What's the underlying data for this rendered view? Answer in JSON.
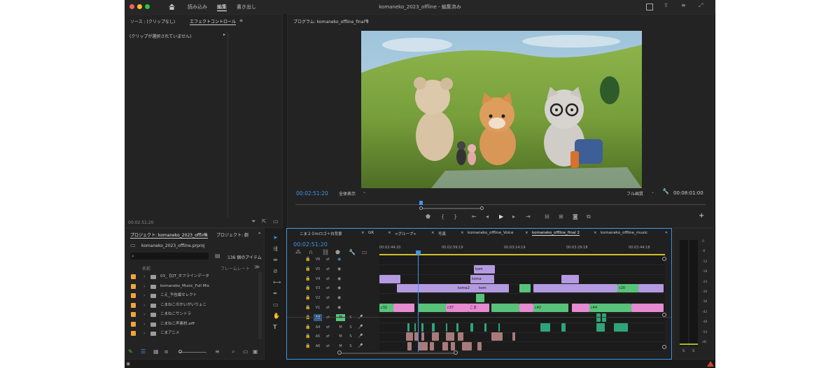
{
  "window": {
    "title": "komaneko_2023_offline - 編集済み"
  },
  "workspaces": [
    {
      "label": "読み込み"
    },
    {
      "label": "編集"
    },
    {
      "label": "書き出し"
    }
  ],
  "source_panel": {
    "tabs": [
      {
        "label": "ソース : (クリップなし)"
      },
      {
        "label": "エフェクトコントロール"
      }
    ],
    "empty_message": "(クリップが選択されていません)",
    "timecode": "00:02:51:20"
  },
  "program_monitor": {
    "tab_label": "プログラム: komaneko_offline_final 2",
    "timecode": "00:02:51:20",
    "fit": "全体表示",
    "quality": "フル画質",
    "duration": "00:08:01:00"
  },
  "project_panel": {
    "tabs": [
      {
        "label": "プロジェクト: komaneko_2023_offline"
      },
      {
        "label": "プロジェクト: 劇"
      }
    ],
    "project_file": "komaneko_2023_offline.prproj",
    "item_count": "136 個のアイテム",
    "col_name": "名前",
    "col_framerate": "フレームレート",
    "items": [
      {
        "label": "03_【QT_オフラインデータ"
      },
      {
        "label": "komaneko_Music_Full Mix"
      },
      {
        "label": "こえ_予告編セレクト"
      },
      {
        "label": "こまねこのかいがいりょこ"
      },
      {
        "label": "こまねこサントラ"
      },
      {
        "label": "こまねこ声素材.aiff"
      },
      {
        "label": "こまアニメ"
      }
    ]
  },
  "timeline": {
    "tabs": [
      {
        "label": "こま２０thロゴ＋白背景"
      },
      {
        "label": "GR"
      },
      {
        "label": "<グループ>"
      },
      {
        "label": "写真"
      },
      {
        "label": "komaneko_offline_Voice"
      },
      {
        "label": "komaneko_offline_final 2"
      },
      {
        "label": "komaneko_offline_music"
      }
    ],
    "timecode": "00:02:51:20",
    "ruler": [
      "00:02:44:20",
      "00:02:59:19",
      "00:03:14:19",
      "00:03:29:18",
      "00:03:44:18"
    ],
    "video_tracks": [
      "V6",
      "V5",
      "V4",
      "V3",
      "V2",
      "V1"
    ],
    "audio_tracks": [
      "A3",
      "A4",
      "A5",
      "A6"
    ],
    "clip_labels": {
      "kom1": "kom",
      "koma": "koma",
      "koma2": "koma2",
      "kom2": "kom",
      "c20": "c20",
      "c32": "c32",
      "c37": "c37",
      "koma_v1": "こま",
      "c42": "c42",
      "c44": "c44"
    },
    "mute": "M",
    "solo": "S"
  },
  "meter": {
    "scale": [
      "0",
      "-6",
      "-12",
      "-18",
      "-24",
      "-30",
      "-36",
      "-42",
      "-48",
      "-54",
      "dB"
    ],
    "solo_left": "S",
    "solo_right": "S"
  },
  "colors": {
    "accent": "#3d95e8",
    "bin": "#f0a53a",
    "video_clip": "#b49ae0",
    "green_clip": "#58c27a",
    "pink_clip": "#e68ad2",
    "audio_clip": "#2fa47a"
  }
}
